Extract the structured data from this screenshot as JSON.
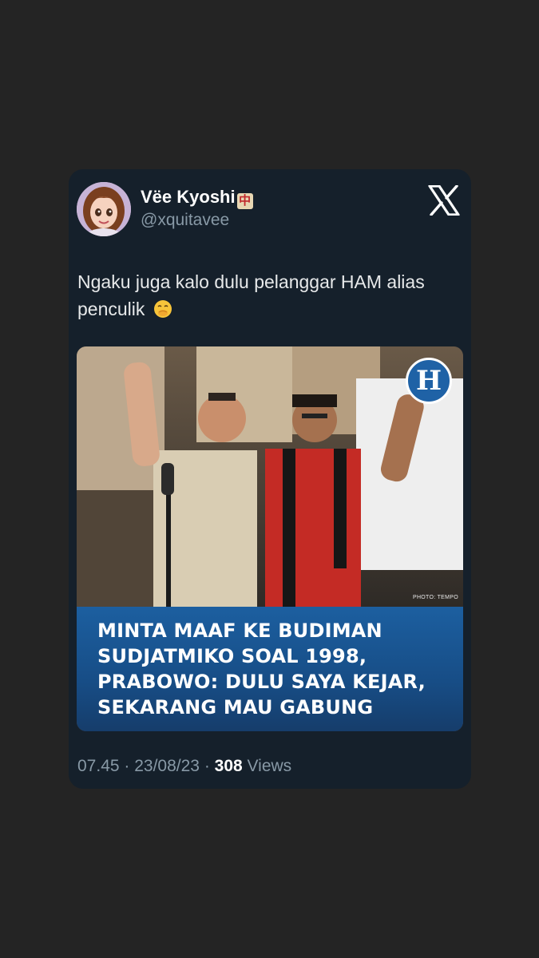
{
  "tweet": {
    "author": {
      "display_name": "Vëe Kyoshi",
      "badge_glyph": "中",
      "handle": "@xquitavee"
    },
    "text": "Ngaku juga kalo dulu pelanggar HAM alias penculik",
    "text_emoji": "face-with-hand-over-mouth",
    "media": {
      "logo_letter": "H",
      "photo_credit": "PHOTO: TEMPO",
      "headline_lines": [
        "MINTA MAAF KE BUDIMAN",
        "SUDJATMIKO SOAL 1998,",
        "PRABOWO: DULU SAYA KEJAR,",
        "SEKARANG MAU GABUNG"
      ]
    },
    "meta": {
      "time": "07.45",
      "sep1": " · ",
      "date": "23/08/23",
      "sep2": " · ",
      "views_count": "308",
      "views_label": " Views"
    }
  },
  "colors": {
    "page_bg": "#242424",
    "card_bg": "#15202b",
    "muted_text": "#8899a6",
    "headline_panel": "#1c5fa0"
  },
  "icons": {
    "platform": "x-logo-icon"
  }
}
